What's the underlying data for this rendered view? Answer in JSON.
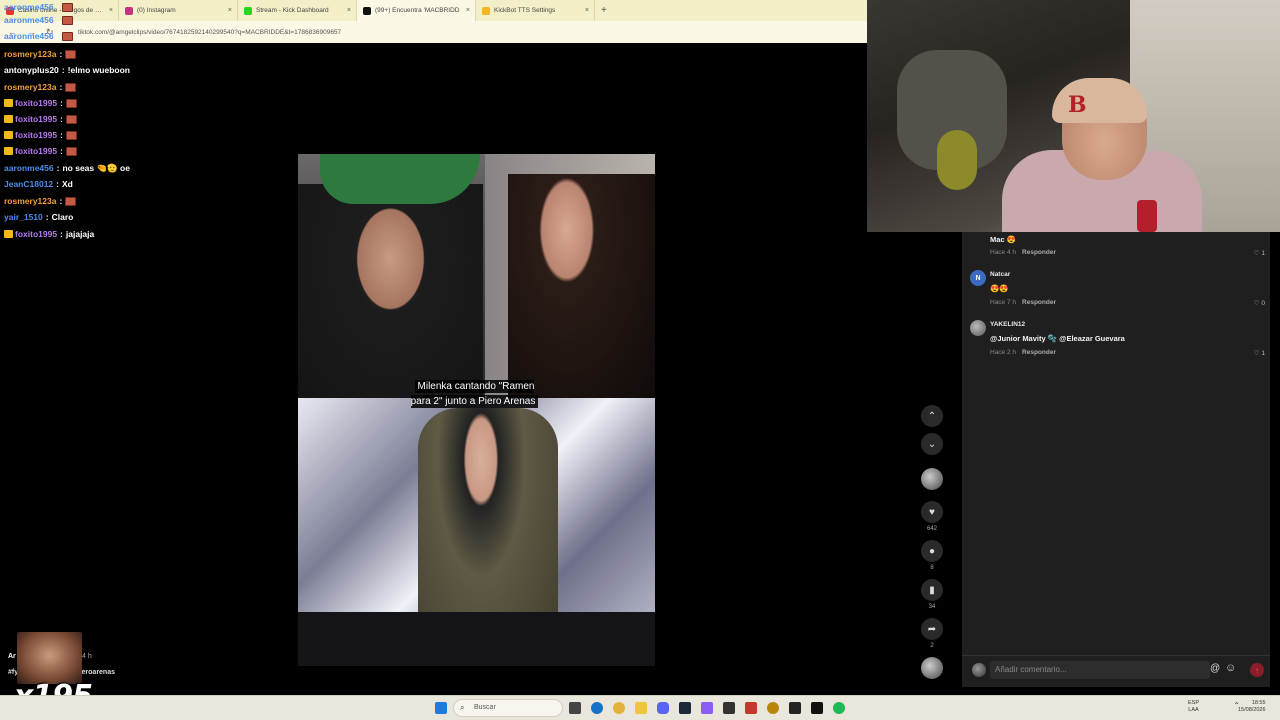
{
  "browser": {
    "tabs": [
      {
        "label": "Casino online - Juegos de casin",
        "color": "#d33"
      },
      {
        "label": "(0) Instagram",
        "color": "#c13584"
      },
      {
        "label": "Stream - Kick Dashboard",
        "color": "#2bd421"
      },
      {
        "label": "(99+) Encuentra 'MACBRIDD",
        "color": "#111"
      },
      {
        "label": "KickBot TTS Settings",
        "color": "#f3b81a"
      }
    ],
    "active_tab": 3,
    "new_tab": "+",
    "url": "tiktok.com/@amgelclips/video/7674182592140299540?q=MACBRIDDE&t=1786836909657"
  },
  "chat": {
    "messages": [
      {
        "user": "aaronme456",
        "text": "",
        "color": "c-blue",
        "badge": false,
        "emote": true
      },
      {
        "user": "aaronme456",
        "text": "",
        "color": "c-blue",
        "badge": false,
        "emote": true
      },
      {
        "user": "aaronme456",
        "text": "",
        "color": "c-blue",
        "badge": false,
        "emote": true
      },
      {
        "user": "rosmery123a",
        "text": "",
        "color": "c-orange",
        "badge": false,
        "emote": true
      },
      {
        "user": "antonyplus20",
        "text": "!elmo wueboon",
        "color": "c-white",
        "badge": false,
        "emote": false
      },
      {
        "user": "rosmery123a",
        "text": "",
        "color": "c-orange",
        "badge": false,
        "emote": true
      },
      {
        "user": "foxito1995",
        "text": "",
        "color": "c-purple",
        "badge": true,
        "emote": true
      },
      {
        "user": "foxito1995",
        "text": "",
        "color": "c-purple",
        "badge": true,
        "emote": true
      },
      {
        "user": "foxito1995",
        "text": "",
        "color": "c-purple",
        "badge": true,
        "emote": true
      },
      {
        "user": "foxito1995",
        "text": "",
        "color": "c-purple",
        "badge": true,
        "emote": true
      },
      {
        "user": "aaronme456",
        "text": "no seas 🤏🫡 oe",
        "color": "c-blue",
        "badge": false,
        "emote": false
      },
      {
        "user": "JeanC18012",
        "text": "Xd",
        "color": "c-blue",
        "badge": false,
        "emote": false
      },
      {
        "user": "rosmery123a",
        "text": "",
        "color": "c-orange",
        "badge": false,
        "emote": true
      },
      {
        "user": "yair_1510",
        "text": "Claro",
        "color": "c-blue",
        "badge": false,
        "emote": false
      },
      {
        "user": "foxito1995",
        "text": "jajajaja",
        "color": "c-purple",
        "badge": true,
        "emote": false
      }
    ]
  },
  "video": {
    "caption": "Milenka cantando \"Ramen para 2\" junto a Piero Arenas"
  },
  "rail": {
    "likes": "642",
    "comments": "8",
    "saves": "34",
    "shares": "2"
  },
  "comments": [
    {
      "name": "",
      "initial": "",
      "text": "Mac 😍",
      "time": "Hace 4 h",
      "reply": "Responder",
      "likes": "1"
    },
    {
      "name": "Natcar",
      "initial": "N",
      "text": "😍😍",
      "time": "Hace 7 h",
      "reply": "Responder",
      "likes": "0"
    },
    {
      "name": "YAKELIN12",
      "initial": "",
      "text": "@Junior Mavity 🫧 @Eleazar Guevara",
      "time": "Hace 2 h",
      "reply": "Responder",
      "likes": "1"
    }
  ],
  "comment_input": {
    "placeholder": "Añadir comentario..."
  },
  "description": {
    "user": "Ar",
    "time": "4 h",
    "tags": "#fy  ·  a #macbridde #pieroarenas"
  },
  "overlay": {
    "counter": "x195"
  },
  "taskbar": {
    "search": "Buscar",
    "lang_line1": "ESP",
    "lang_line2": "LAA",
    "time": "18:55",
    "date": "15/08/2026"
  }
}
